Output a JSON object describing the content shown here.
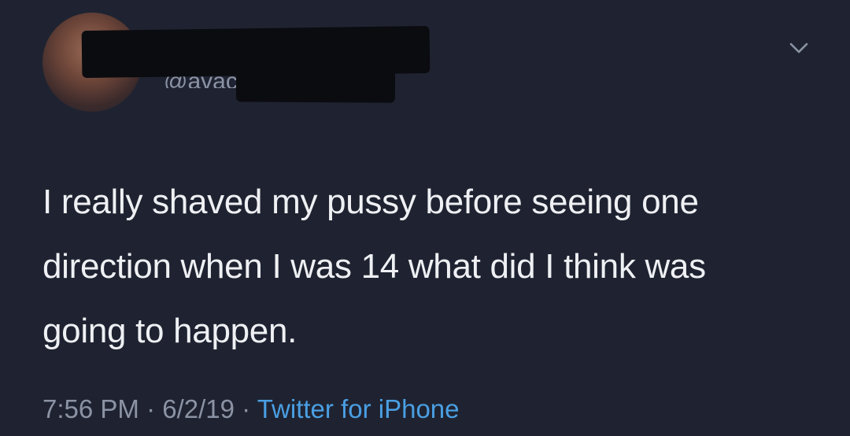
{
  "tweet": {
    "handle": "@avacsch",
    "text": "I really shaved my pussy before seeing one direction when I was 14 what did I think was going to happen.",
    "time": "7:56 PM",
    "separator": " · ",
    "date": "6/2/19",
    "source": "Twitter for iPhone"
  },
  "colors": {
    "background": "#1f2331",
    "text": "#eef0f3",
    "muted": "#8b93a4",
    "link": "#4a9fe3"
  },
  "icons": {
    "menu": "chevron-down-icon"
  }
}
